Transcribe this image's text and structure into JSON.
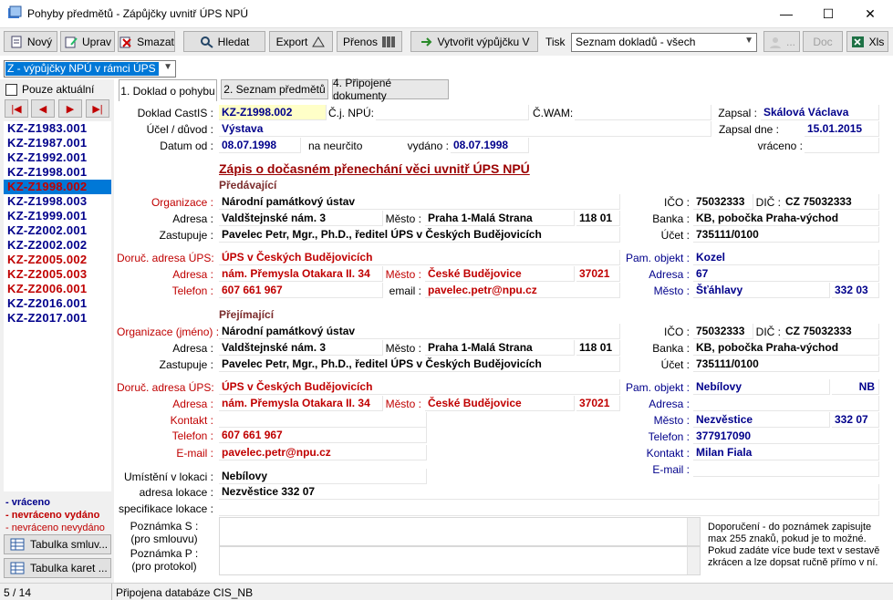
{
  "window": {
    "title": "Pohyby předmětů - Zápůjčky uvnitř ÚPS NPÚ"
  },
  "toolbar": {
    "new": "Nový",
    "edit": "Uprav",
    "delete": "Smazat",
    "search": "Hledat",
    "export": "Export",
    "transfer": "Přenos",
    "create": "Vytvořit výpůjčku V",
    "print_label": "Tisk",
    "print_select": "Seznam dokladů - všech",
    "dots": "...",
    "doc": "Doc",
    "xls": "Xls"
  },
  "filter": {
    "selected": "Z - výpůjčky NPÚ v rámci ÚPS"
  },
  "only_current": "Pouze aktuální",
  "doclist": [
    {
      "id": "KZ-Z1983.001",
      "color": "blue"
    },
    {
      "id": "KZ-Z1987.001",
      "color": "blue"
    },
    {
      "id": "KZ-Z1992.001",
      "color": "blue"
    },
    {
      "id": "KZ-Z1998.001",
      "color": "blue"
    },
    {
      "id": "KZ-Z1998.002",
      "color": "red",
      "selected": true
    },
    {
      "id": "KZ-Z1998.003",
      "color": "blue"
    },
    {
      "id": "KZ-Z1999.001",
      "color": "blue"
    },
    {
      "id": "KZ-Z2002.001",
      "color": "blue"
    },
    {
      "id": "KZ-Z2002.002",
      "color": "blue"
    },
    {
      "id": "KZ-Z2005.002",
      "color": "red"
    },
    {
      "id": "KZ-Z2005.003",
      "color": "red"
    },
    {
      "id": "KZ-Z2006.001",
      "color": "red"
    },
    {
      "id": "KZ-Z2016.001",
      "color": "blue"
    },
    {
      "id": "KZ-Z2017.001",
      "color": "blue"
    }
  ],
  "legend": {
    "returned": "- vráceno",
    "not_returned_issued": "- nevráceno vydáno",
    "not_returned_not_issued": "- nevráceno nevydáno"
  },
  "side_buttons": {
    "contracts": "Tabulka smluv...",
    "cards": "Tabulka karet ..."
  },
  "tabs": [
    "1. Doklad  o pohybu",
    "2. Seznam předmětů",
    "4. Připojené dokumenty"
  ],
  "header": {
    "doc_label": "Doklad CastIS :",
    "doc_value": "KZ-Z1998.002",
    "cj_label": "Č.j. NPÚ:",
    "wam_label": "Č.WAM:",
    "wrote_label": "Zapsal :",
    "wrote_value": "Skálová Václava",
    "purpose_label": "Účel / důvod :",
    "purpose_value": "Výstava",
    "wrote_date_label": "Zapsal dne :",
    "wrote_date_value": "15.01.2015",
    "date_from_label": "Datum od :",
    "date_from_value": "08.07.1998",
    "indefinite": "na neurčito",
    "issued_label": "vydáno :",
    "issued_value": "08.07.1998",
    "returned_label": "vráceno :"
  },
  "main_heading": "Zápis o dočasném přenechání věci uvnitř ÚPS NPÚ",
  "giver": {
    "section": "Předávající",
    "org_label": "Organizace :",
    "org_value": "Národní památkový ústav",
    "addr_label": "Adresa :",
    "addr_value": "Valdštejnské nám. 3",
    "city_label": "Město :",
    "city_value": "Praha 1-Malá Strana",
    "zip_value": "118 01",
    "rep_label": "Zastupuje :",
    "rep_value": "Pavelec Petr, Mgr., Ph.D., ředitel ÚPS v Českých Budějovicích",
    "ico_label": "IČO :",
    "ico_value": "75032333",
    "dic_label": "DIČ :",
    "dic_value": "CZ 75032333",
    "bank_label": "Banka :",
    "bank_value": "KB, pobočka Praha-východ",
    "account_label": "Účet :",
    "account_value": "735111/0100",
    "deliv_label": "Doruč. adresa ÚPS:",
    "deliv_value": "ÚPS v Českých Budějovicích",
    "daddr_label": "Adresa :",
    "daddr_value": "nám. Přemysla Otakara II. 34",
    "dcity_label": "Město :",
    "dcity_value": "České Budějovice",
    "dzip_value": "37021",
    "phone_label": "Telefon :",
    "phone_value": "607 661 967",
    "email_label": "email :",
    "email_value": "pavelec.petr@npu.cz",
    "mon_label": "Pam. objekt :",
    "mon_value": "Kozel",
    "maddr_label": "Adresa :",
    "maddr_value": "67",
    "mcity_label": "Město :",
    "mcity_value": "Šťáhlavy",
    "mzip_value": "332 03"
  },
  "receiver": {
    "section": "Přejímající",
    "org_label": "Organizace (jméno) :",
    "org_value": "Národní památkový ústav",
    "addr_label": "Adresa :",
    "addr_value": "Valdštejnské nám. 3",
    "city_label": "Město :",
    "city_value": "Praha 1-Malá Strana",
    "zip_value": "118 01",
    "rep_label": "Zastupuje :",
    "rep_value": "Pavelec Petr, Mgr., Ph.D., ředitel ÚPS v Českých Budějovicích",
    "ico_label": "IČO :",
    "ico_value": "75032333",
    "dic_label": "DIČ :",
    "dic_value": "CZ 75032333",
    "bank_label": "Banka :",
    "bank_value": "KB, pobočka Praha-východ",
    "account_label": "Účet :",
    "account_value": "735111/0100",
    "deliv_label": "Doruč. adresa ÚPS:",
    "deliv_value": "ÚPS v Českých Budějovicích",
    "daddr_label": "Adresa :",
    "daddr_value": "nám. Přemysla Otakara II. 34",
    "dcity_label": "Město :",
    "dcity_value": "České Budějovice",
    "dzip_value": "37021",
    "contact_label": "Kontakt :",
    "phone_label": "Telefon :",
    "phone_value": "607 661 967",
    "email_label": "E-mail :",
    "email_value": "pavelec.petr@npu.cz",
    "mon_label": "Pam. objekt :",
    "mon_value": "Nebílovy",
    "mon_code": "NB",
    "maddr_label": "Adresa :",
    "mcity_label": "Město :",
    "mcity_value": "Nezvěstice",
    "mzip_value": "332 07",
    "mphone_label": "Telefon :",
    "mphone_value": "377917090",
    "mcontact_label": "Kontakt :",
    "mcontact_value": "Milan Fiala",
    "memail_label": "E-mail :"
  },
  "location": {
    "place_label": "Umístění v lokaci :",
    "place_value": "Nebílovy",
    "addr_label": "adresa lokace :",
    "addr_value": "Nezvěstice 332 07",
    "spec_label": "specifikace lokace :",
    "note_s_label1": "Poznámka S :",
    "note_s_label2": "(pro smlouvu)",
    "note_p_label1": "Poznámka P :",
    "note_p_label2": "(pro protokol)",
    "hint": "Doporučení - do poznámek zapisujte max 255 znaků, pokud je to možné. Pokud zadáte více bude text v sestavě zkrácen a lze dopsat ručně přímo v ní."
  },
  "status": {
    "position": "5 / 14",
    "db": "Připojena databáze CIS_NB"
  }
}
